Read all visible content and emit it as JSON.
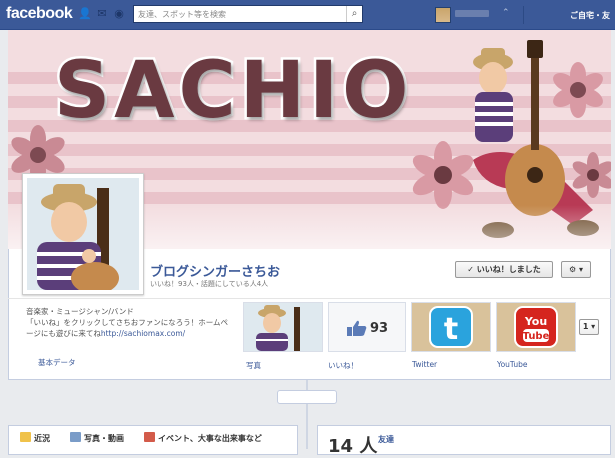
{
  "topbar": {
    "logo": "facebook",
    "search_placeholder": "友達、スポット等を検索",
    "home_label": "ご自宅・友",
    "icons": [
      "friends-icon",
      "messages-icon",
      "notifications-icon",
      "search-icon",
      "chevron-down-icon"
    ]
  },
  "cover": {
    "banner_text": "SACHIO"
  },
  "page": {
    "name": "ブログシンガーさちお",
    "stats": "いいね！93人・話題にしている人4人",
    "like_button": "✓ いいね！しました",
    "settings_button": "⚙ ▾"
  },
  "about": {
    "category": "音楽家・ミュージシャン/バンド",
    "description": "「いいね」をクリックしてさちおファンになろう！ホームページにも遊びに来てね",
    "url": "http://sachiomax.com/",
    "label": "基本データ"
  },
  "tiles": [
    {
      "label": "写真"
    },
    {
      "label": "いいね！",
      "count": "93"
    },
    {
      "label": "Twitter",
      "logo_text": "t"
    },
    {
      "label": "YouTube",
      "logo_text": "You Tube"
    }
  ],
  "more_button": "1 ▾",
  "composer": {
    "tabs": [
      "近況",
      "写真・動画",
      "イベント、大事な出来事など"
    ]
  },
  "friends": {
    "count": "14 人",
    "label": "友達"
  },
  "colors": {
    "brand": "#3b5998",
    "cover_text": "#6a3a41",
    "twitter": "#2aa3dd",
    "youtube": "#d5251e"
  }
}
